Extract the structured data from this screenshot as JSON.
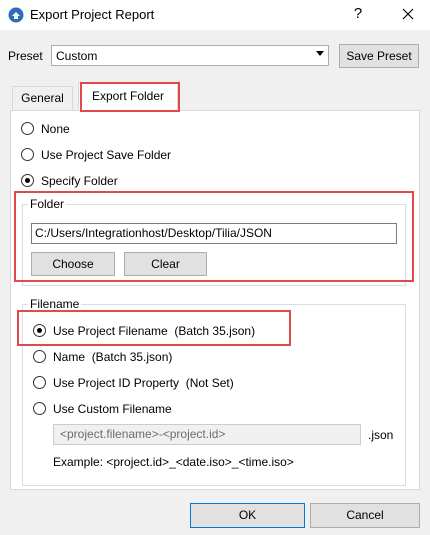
{
  "window": {
    "title": "Export Project Report",
    "help_glyph": "?",
    "close_glyph": "✕"
  },
  "preset": {
    "label": "Preset",
    "selected": "Custom",
    "save_label": "Save Preset"
  },
  "tabs": [
    {
      "label": "General",
      "active": false
    },
    {
      "label": "Export Folder",
      "active": true
    }
  ],
  "folder_options": {
    "none": "None",
    "project_save": "Use Project Save Folder",
    "specify": "Specify Folder",
    "selected": "specify"
  },
  "folder_group": {
    "title": "Folder",
    "path": "C:/Users/Integrationhost/Desktop/Tilia/JSON",
    "choose_label": "Choose",
    "clear_label": "Clear"
  },
  "filename_group": {
    "title": "Filename",
    "options": [
      {
        "label": "Use Project Filename",
        "detail": "(Batch 35.json)",
        "checked": true
      },
      {
        "label": "Name",
        "detail": "(Batch 35.json)",
        "checked": false
      },
      {
        "label": "Use Project ID Property",
        "detail": "(Not Set)",
        "checked": false
      },
      {
        "label": "Use Custom Filename",
        "detail": "",
        "checked": false
      }
    ],
    "custom_pattern": "<project.filename>-<project.id>",
    "suffix": ".json",
    "example": "Example:  <project.id>_<date.iso>_<time.iso>"
  },
  "footer": {
    "ok_label": "OK",
    "cancel_label": "Cancel"
  },
  "colors": {
    "highlight": "#e04a4a",
    "accent": "#0078d7"
  }
}
